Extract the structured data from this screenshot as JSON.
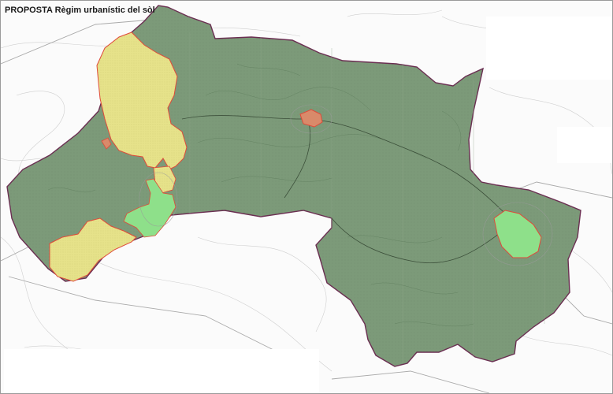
{
  "map": {
    "title_bold": "PROPOSTA",
    "title_rest": " Règim urbanístic del sòl",
    "colors": {
      "non_developable": "#7a9a78",
      "non_developable_stroke": "#6b2f52",
      "urban_yellow": "#e8e48a",
      "urban_green": "#8ee08a",
      "boundary_red": "#e04a3a",
      "topo_line": "#c9c9c9",
      "road": "#9a9a9a"
    },
    "regions": [
      {
        "name": "municipal-territory",
        "class": "non-developable land"
      },
      {
        "name": "urban-area-north",
        "class": "urban"
      },
      {
        "name": "urban-area-south",
        "class": "urban"
      },
      {
        "name": "green-zone-west",
        "class": "green"
      },
      {
        "name": "green-zone-east",
        "class": "green"
      },
      {
        "name": "nucleus-centre",
        "class": "urban nucleus"
      }
    ]
  }
}
